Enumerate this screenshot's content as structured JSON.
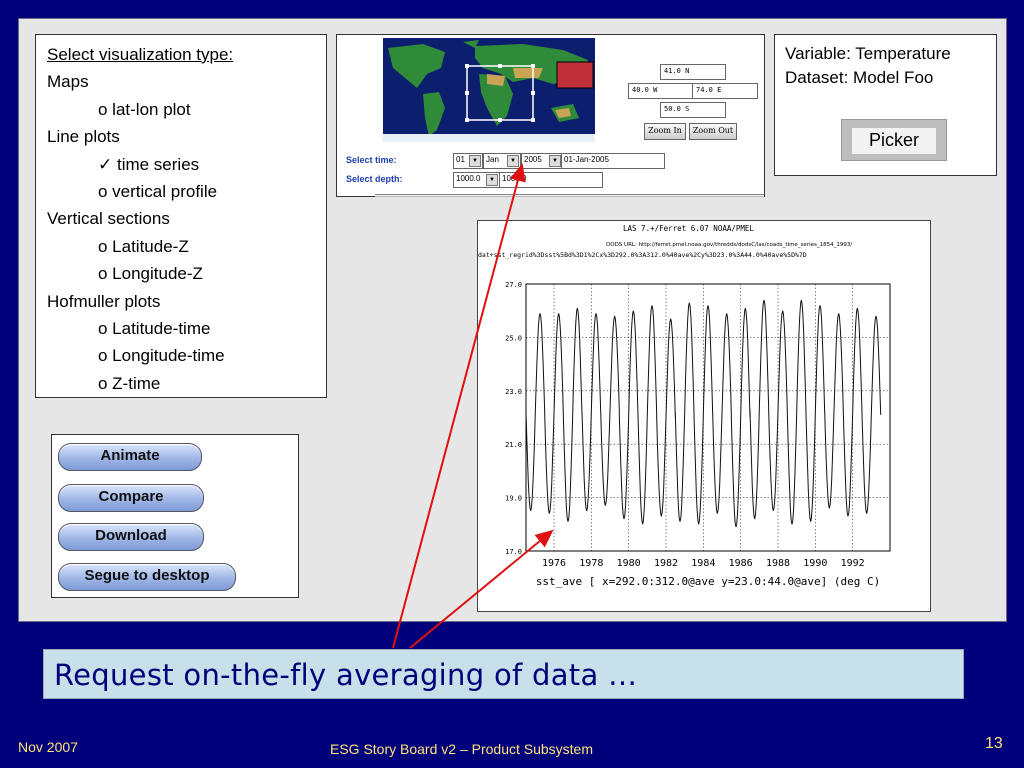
{
  "viz": {
    "heading": "Select visualization type:",
    "items": [
      {
        "text": "Maps",
        "level": 1
      },
      {
        "text": "o lat-lon plot",
        "level": 2
      },
      {
        "text": "Line plots",
        "level": 1
      },
      {
        "text": "✓ time series",
        "level": 2
      },
      {
        "text": "o vertical profile",
        "level": 2
      },
      {
        "text": "Vertical sections",
        "level": 1
      },
      {
        "text": "o Latitude-Z",
        "level": 2
      },
      {
        "text": "o Longitude-Z",
        "level": 2
      },
      {
        "text": "Hofmuller plots",
        "level": 1
      },
      {
        "text": "o Latitude-time",
        "level": 2
      },
      {
        "text": "o Longitude-time",
        "level": 2
      },
      {
        "text": "o Z-time",
        "level": 2
      }
    ]
  },
  "actions": {
    "animate": "Animate",
    "compare": "Compare",
    "download": "Download",
    "segue": "Segue to desktop"
  },
  "map": {
    "north": "41.0 N",
    "west": "40.0 W",
    "east": "74.0 E",
    "south": "50.0 S",
    "zoom_in": "Zoom In",
    "zoom_out": "Zoom Out",
    "time_label": "Select time:",
    "day": "01",
    "month": "Jan",
    "year": "2005",
    "date_text": "01-Jan-2005",
    "depth_label": "Select depth:",
    "depth": "1000.0",
    "depth_text": "1000.0"
  },
  "variable": {
    "variable_line": "Variable: Temperature",
    "dataset_line": "Dataset: Model Foo",
    "picker": "Picker"
  },
  "plot": {
    "header": "LAS 7.+/Ferret 6.07        NOAA/PMEL",
    "dods": "DODS URL: http://ferret.pmel.noaa.gov/thredds/dodsC/las/coads_time_series_1854_1993/",
    "query": "dat+sst_regrid%3Dsst%5Bd%3D1%2Cx%3D292.0%3A312.0%40ave%2Cy%3D23.0%3A44.0%40ave%5D%7D",
    "xlabel": "sst_ave [ x=292.0:312.0@ave y=23.0:44.0@ave] (deg C)"
  },
  "chart_data": {
    "type": "line",
    "title": "",
    "xlabel": "sst_ave [ x=292.0:312.0@ave y=23.0:44.0@ave] (deg C)",
    "ylabel": "",
    "xlim": [
      1974.5,
      1994
    ],
    "ylim": [
      17.0,
      27.0
    ],
    "x_ticks": [
      "1976",
      "1978",
      "1980",
      "1982",
      "1984",
      "1986",
      "1988",
      "1990",
      "1992"
    ],
    "y_ticks": [
      "17.0",
      "19.0",
      "21.0",
      "23.0",
      "25.0",
      "27.0"
    ],
    "series": [
      {
        "period": 1,
        "years": [
          1975,
          1976,
          1977,
          1978,
          1979,
          1980,
          1981,
          1982,
          1983,
          1984,
          1985,
          1986,
          1987,
          1988,
          1989,
          1990,
          1991,
          1992,
          1993
        ],
        "max": [
          25.9,
          25.9,
          26.1,
          25.9,
          25.8,
          26.0,
          26.2,
          25.7,
          26.3,
          26.2,
          25.9,
          26.1,
          26.4,
          26.0,
          26.4,
          26.2,
          25.9,
          26.1,
          25.8
        ],
        "min": [
          18.5,
          18.4,
          18.1,
          18.5,
          18.7,
          18.2,
          18.0,
          18.3,
          18.1,
          18.0,
          18.4,
          17.9,
          18.2,
          18.5,
          18.0,
          18.1,
          18.6,
          18.3,
          18.4
        ],
        "grid": true
      }
    ]
  },
  "caption": "Request on-the-fly averaging of data …",
  "footer": {
    "date": "Nov 2007",
    "title": "ESG Story Board v2 – Product Subsystem",
    "page": "13"
  }
}
